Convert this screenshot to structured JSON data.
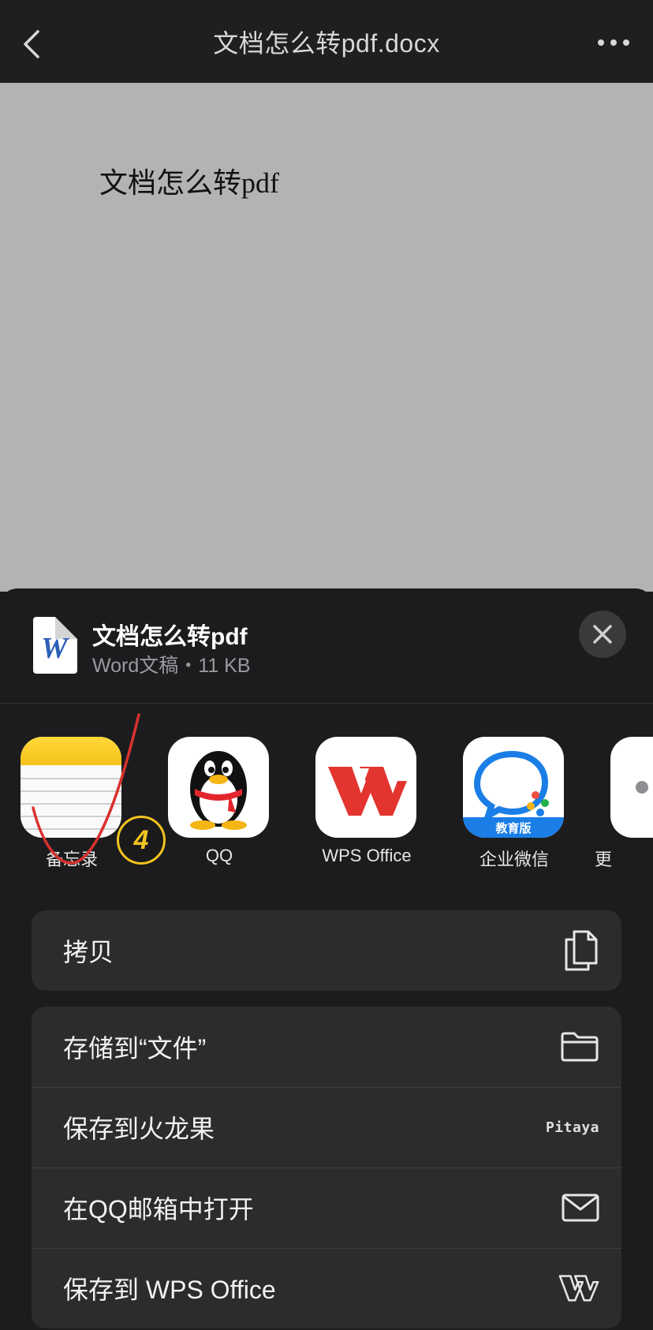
{
  "nav": {
    "title": "文档怎么转pdf.docx"
  },
  "preview": {
    "text": "文档怎么转pdf"
  },
  "share_sheet": {
    "file_name": "文档怎么转pdf",
    "file_meta": "Word文稿・11 KB",
    "annotation_badge": "4",
    "apps": [
      {
        "label": "备忘录",
        "icon": "notes-app-icon"
      },
      {
        "label": "QQ",
        "icon": "qq-app-icon"
      },
      {
        "label": "WPS Office",
        "icon": "wps-office-app-icon"
      },
      {
        "label": "企业微信",
        "icon": "wecom-app-icon",
        "sub": "教育版"
      },
      {
        "label": "更",
        "icon": "more-apps-icon"
      }
    ],
    "actions_group1": [
      {
        "label": "拷贝",
        "icon": "copy-icon"
      }
    ],
    "actions_group2": [
      {
        "label": "存储到“文件”",
        "icon": "folder-icon"
      },
      {
        "label": "保存到火龙果",
        "icon": "pitaya-icon",
        "icon_text": "Pitaya"
      },
      {
        "label": "在QQ邮箱中打开",
        "icon": "mail-icon"
      },
      {
        "label": "保存到 WPS Office",
        "icon": "wps-icon"
      }
    ]
  },
  "colors": {
    "nav_bg": "#1f1f21",
    "preview_bg": "#b3b3b3",
    "sheet_bg": "#1c1c1e",
    "row_bg": "#2c2c2e",
    "annotation": "#d8322e",
    "badge": "#f1c41f"
  }
}
